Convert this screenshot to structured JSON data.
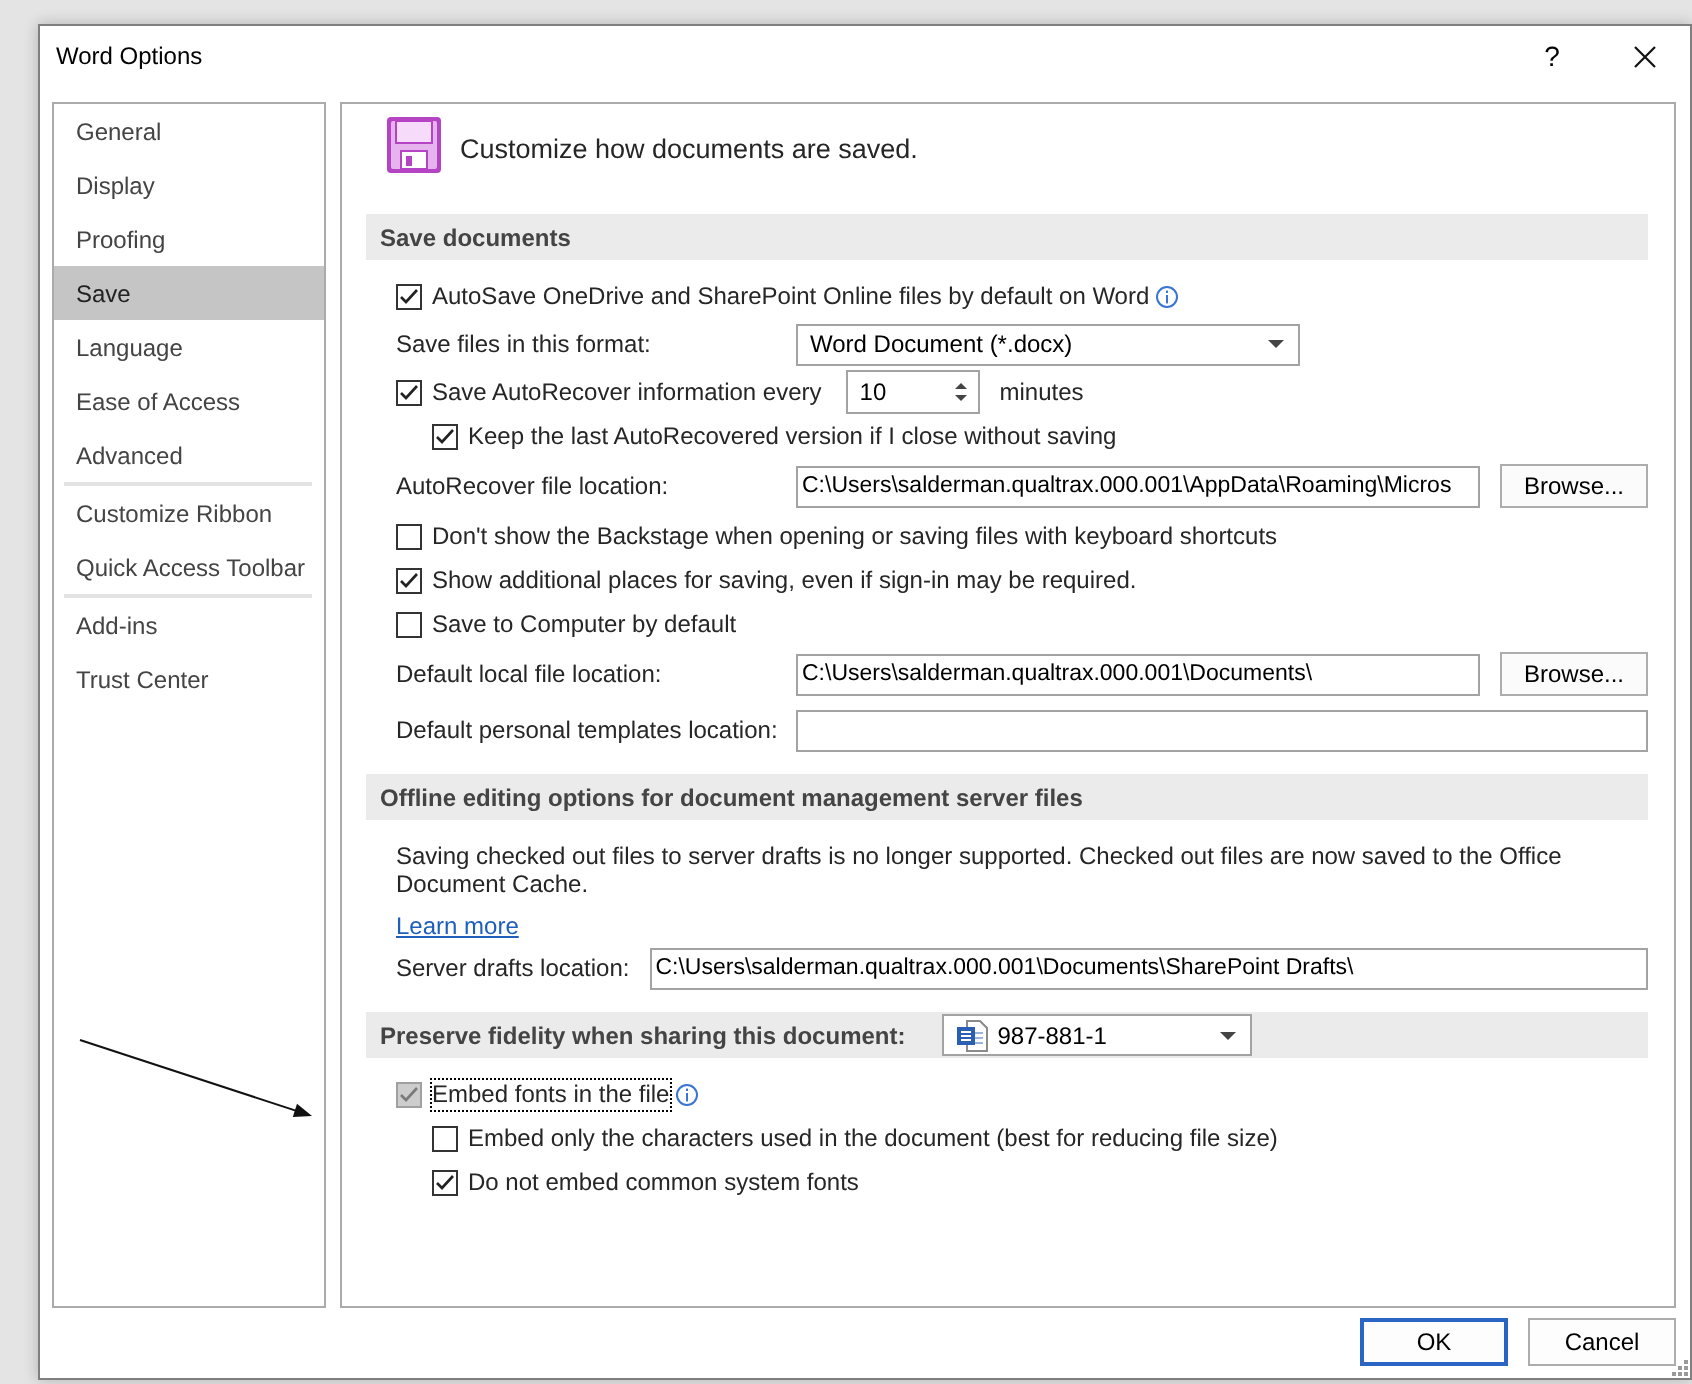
{
  "window": {
    "title": "Word Options",
    "help": "?"
  },
  "sidebar": {
    "groups": [
      [
        {
          "label": "General",
          "selected": false
        },
        {
          "label": "Display",
          "selected": false
        },
        {
          "label": "Proofing",
          "selected": false
        },
        {
          "label": "Save",
          "selected": true
        },
        {
          "label": "Language",
          "selected": false
        },
        {
          "label": "Ease of Access",
          "selected": false
        },
        {
          "label": "Advanced",
          "selected": false
        }
      ],
      [
        {
          "label": "Customize Ribbon",
          "selected": false
        },
        {
          "label": "Quick Access Toolbar",
          "selected": false
        }
      ],
      [
        {
          "label": "Add-ins",
          "selected": false
        },
        {
          "label": "Trust Center",
          "selected": false
        }
      ]
    ]
  },
  "header": {
    "text": "Customize how documents are saved."
  },
  "sections": [
    {
      "title": "Save documents",
      "rows": [
        {
          "kind": "checkbox",
          "label": "AutoSave OneDrive and SharePoint Online files by default on Word",
          "checked": true,
          "focused": false,
          "info": true
        },
        {
          "kind": "select",
          "label": "Save files in this format:",
          "value": "Word Document (*.docx)"
        },
        {
          "kind": "checkbox_spin",
          "label": "Save AutoRecover information every",
          "checked": true,
          "focused": false,
          "value": "10",
          "unit": "minutes",
          "children": [
            {
              "kind": "checkbox",
              "label": "Keep the last AutoRecovered version if I close without saving",
              "checked": true,
              "focused": false
            }
          ]
        },
        {
          "kind": "path",
          "label": "AutoRecover file location:",
          "value": "C:\\Users\\salderman.qualtrax.000.001\\AppData\\Roaming\\Micros",
          "button": "Browse..."
        },
        {
          "kind": "checkbox",
          "label": "Don't show the Backstage when opening or saving files with keyboard shortcuts",
          "checked": false,
          "focused": false
        },
        {
          "kind": "checkbox",
          "label": "Show additional places for saving, even if sign-in may be required.",
          "checked": true,
          "focused": false
        },
        {
          "kind": "checkbox",
          "label": "Save to Computer by default",
          "checked": false,
          "focused": false
        },
        {
          "kind": "path",
          "label": "Default local file location:",
          "value": "C:\\Users\\salderman.qualtrax.000.001\\Documents\\",
          "button": "Browse..."
        },
        {
          "kind": "path",
          "label": "Default personal templates location:"
        }
      ]
    },
    {
      "title": "Offline editing options for document management server files",
      "rows": [
        {
          "kind": "text",
          "text": "Saving checked out files to server drafts is no longer supported. Checked out files are now saved to the Office Document Cache."
        },
        {
          "kind": "link",
          "text": "Learn more"
        },
        {
          "kind": "path_inline",
          "label": "Server drafts location:",
          "value": "C:\\Users\\salderman.qualtrax.000.001\\Documents\\SharePoint Drafts\\"
        }
      ]
    },
    {
      "title": "Preserve fidelity when sharing this document:",
      "document": "987-881-1",
      "rows": [
        {
          "kind": "checkbox",
          "label": "Embed fonts in the file",
          "checked": true,
          "focused": true,
          "info": true,
          "children": [
            {
              "kind": "checkbox",
              "label": "Embed only the characters used in the document (best for reducing file size)",
              "checked": false,
              "focused": false
            },
            {
              "kind": "checkbox",
              "label": "Do not embed common system fonts",
              "checked": true,
              "focused": false
            }
          ]
        }
      ]
    }
  ],
  "buttons": [
    {
      "label": "OK",
      "default": true
    },
    {
      "label": "Cancel",
      "default": false
    }
  ]
}
